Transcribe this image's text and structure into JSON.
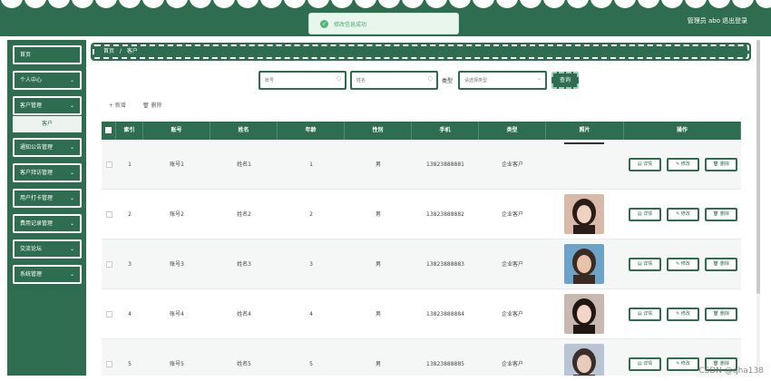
{
  "header": {
    "user_label": "管理员 abo",
    "logout_label": "退出登录",
    "bg_color": "#2e6d4f"
  },
  "toast": {
    "message": "修改信息成功"
  },
  "sidebar": {
    "items": [
      {
        "label": "首页",
        "has_chevron": false
      },
      {
        "label": "个人中心",
        "has_chevron": true
      },
      {
        "label": "客户管理",
        "has_chevron": true
      },
      {
        "label": "通知公告管理",
        "has_chevron": true
      },
      {
        "label": "客户拜访管理",
        "has_chevron": true
      },
      {
        "label": "用户打卡管理",
        "has_chevron": true
      },
      {
        "label": "费用记录管理",
        "has_chevron": true
      },
      {
        "label": "交流论坛",
        "has_chevron": true
      },
      {
        "label": "系统管理",
        "has_chevron": true
      }
    ],
    "active_submenu": "客户"
  },
  "breadcrumb": {
    "home": "首页",
    "separator": "/",
    "current": "客户"
  },
  "search": {
    "account_placeholder": "账号",
    "name_placeholder": "姓名",
    "type_label": "类型",
    "type_placeholder": "请选择类型",
    "query_label": "查询"
  },
  "actions": {
    "add_label": "+ 新增",
    "delete_label": "删除"
  },
  "table": {
    "headers": [
      "索引",
      "账号",
      "姓名",
      "年龄",
      "性别",
      "手机",
      "类型",
      "照片",
      "操作"
    ],
    "rows": [
      {
        "index": "1",
        "account": "账号1",
        "name": "姓名1",
        "age": "1",
        "gender": "男",
        "phone": "13823888881",
        "type": "企业客户",
        "has_photo": false
      },
      {
        "index": "2",
        "account": "账号2",
        "name": "姓名2",
        "age": "2",
        "gender": "男",
        "phone": "13823888882",
        "type": "企业客户",
        "has_photo": true
      },
      {
        "index": "3",
        "account": "账号3",
        "name": "姓名3",
        "age": "3",
        "gender": "男",
        "phone": "13823888883",
        "type": "企业客户",
        "has_photo": true
      },
      {
        "index": "4",
        "account": "账号4",
        "name": "姓名4",
        "age": "4",
        "gender": "男",
        "phone": "13823888884",
        "type": "企业客户",
        "has_photo": true
      },
      {
        "index": "5",
        "account": "账号5",
        "name": "姓名5",
        "age": "5",
        "gender": "男",
        "phone": "13823888885",
        "type": "企业客户",
        "has_photo": true
      }
    ],
    "op_labels": {
      "detail": "详情",
      "edit": "修改",
      "delete": "删除"
    }
  },
  "watermark": "CSDN @qha138"
}
